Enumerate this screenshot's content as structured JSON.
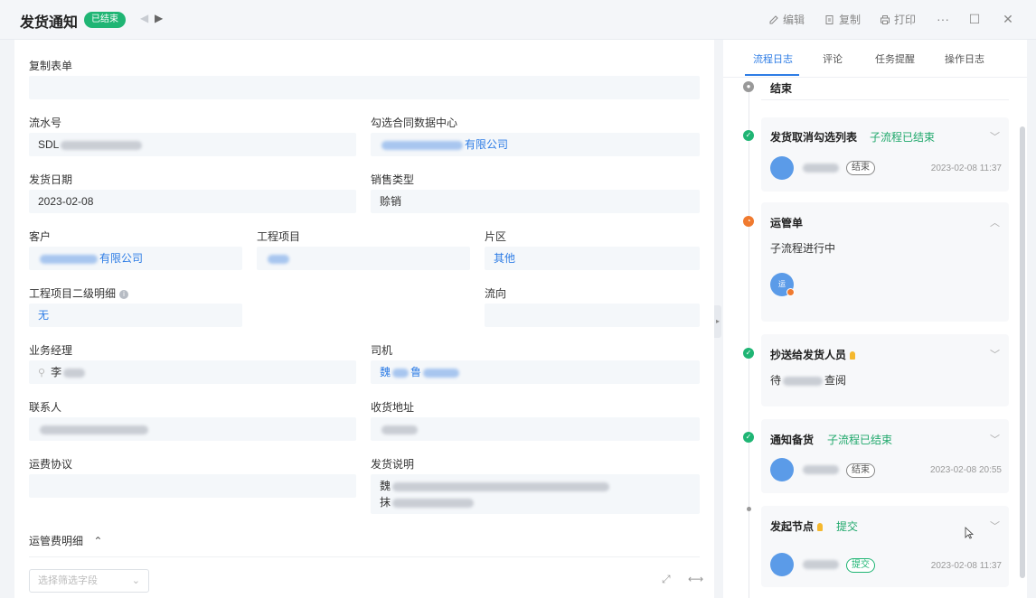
{
  "header": {
    "title": "发货通知",
    "status": "已结束",
    "nav_prev": "◀",
    "nav_next": "▶",
    "toolbar": {
      "edit": "编辑",
      "copy": "复制",
      "print": "打印"
    },
    "more_icon": "···",
    "maximize_icon": "☐",
    "close_icon": "✕"
  },
  "form": {
    "copy_form": {
      "label": "复制表单",
      "value": ""
    },
    "serial_no": {
      "label": "流水号",
      "value": "SDL"
    },
    "contract_center": {
      "label": "勾选合同数据中心",
      "value": "有限公司"
    },
    "ship_date": {
      "label": "发货日期",
      "value": "2023-02-08"
    },
    "sales_type": {
      "label": "销售类型",
      "value": "赊销"
    },
    "customer": {
      "label": "客户",
      "value": "有限公司"
    },
    "project": {
      "label": "工程项目",
      "value": ""
    },
    "region": {
      "label": "片区",
      "value": "其他"
    },
    "project_detail": {
      "label": "工程项目二级明细",
      "value": "无",
      "info_icon": "i"
    },
    "flow_direction": {
      "label": "流向",
      "value": ""
    },
    "business_manager": {
      "label": "业务经理",
      "value": "李",
      "person_icon": "⚲"
    },
    "driver": {
      "label": "司机",
      "value_a": "魏",
      "value_b": "鲁"
    },
    "contact": {
      "label": "联系人",
      "value": ""
    },
    "delivery_address": {
      "label": "收货地址",
      "value": ""
    },
    "freight_agreement": {
      "label": "运费协议",
      "value": ""
    },
    "shipping_note": {
      "label": "发货说明",
      "line1": "魏",
      "line2": "抹"
    },
    "freight_detail": {
      "label": "运管费明细",
      "collapse_icon": "⌃"
    },
    "filter_select": {
      "placeholder": "选择筛选字段",
      "chevron": "⌄"
    },
    "expand_icon": "⤢",
    "fit_icon": "⟷"
  },
  "panel": {
    "tabs": [
      "流程日志",
      "评论",
      "任务提醒",
      "操作日志"
    ],
    "timeline": {
      "end": {
        "title": "结束"
      },
      "cancel_select": {
        "title": "发货取消勾选列表",
        "status": "子流程已结束",
        "tag": "结束",
        "time": "2023-02-08 11:37"
      },
      "transport": {
        "title": "运管单",
        "body": "子流程进行中",
        "avatar": "运"
      },
      "cc_shipper": {
        "title": "抄送给发货人员",
        "body_prefix": "待",
        "body_suffix": "查阅"
      },
      "notify_prepare": {
        "title": "通知备货",
        "status": "子流程已结束",
        "tag": "结束",
        "time": "2023-02-08 20:55"
      },
      "start_node": {
        "title": "发起节点",
        "status": "提交",
        "tag": "提交",
        "time": "2023-02-08 11:37"
      }
    }
  },
  "colors": {
    "accent": "#2d7ce5",
    "success": "#1fb574",
    "warning": "#f07a2f"
  }
}
